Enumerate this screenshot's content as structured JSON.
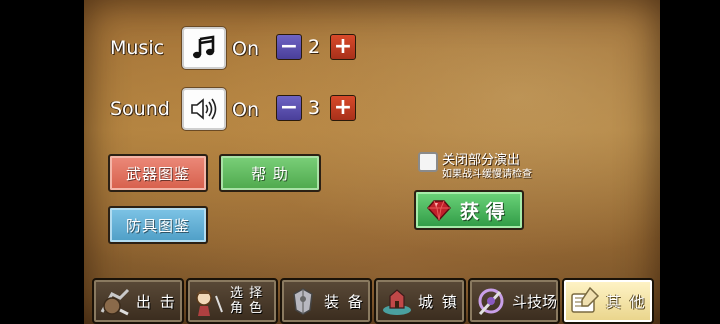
{
  "settings": {
    "music": {
      "label": "Music",
      "state": "On",
      "level": "2",
      "icon": "music-note-icon"
    },
    "sound": {
      "label": "Sound",
      "state": "On",
      "level": "3",
      "icon": "speaker-icon"
    },
    "minus_label": "−",
    "plus_label": "+"
  },
  "buttons": {
    "weapon_codex": "武器图鉴",
    "help": "帮 助",
    "armor_codex": "防具图鉴",
    "obtain": "获 得"
  },
  "checkbox": {
    "title": "关闭部分演出",
    "subtitle": "如果战斗缓慢请检查",
    "checked": false
  },
  "nav": [
    {
      "label": "出 击",
      "icon": "sortie-icon"
    },
    {
      "label_line1": "选 择",
      "label_line2": "角 色",
      "icon": "character-select-icon"
    },
    {
      "label": "装 备",
      "icon": "equipment-icon"
    },
    {
      "label": "城 镇",
      "icon": "town-icon"
    },
    {
      "label": "斗技场",
      "icon": "arena-icon"
    },
    {
      "label": "其 他",
      "icon": "other-icon",
      "active": true
    }
  ],
  "colors": {
    "minus": "#5a50b0",
    "plus": "#c83c22",
    "red_button": "#dc6a56",
    "green_button": "#5cb85a",
    "blue_button": "#5eaed6",
    "obtain_button": "#3fae55"
  }
}
